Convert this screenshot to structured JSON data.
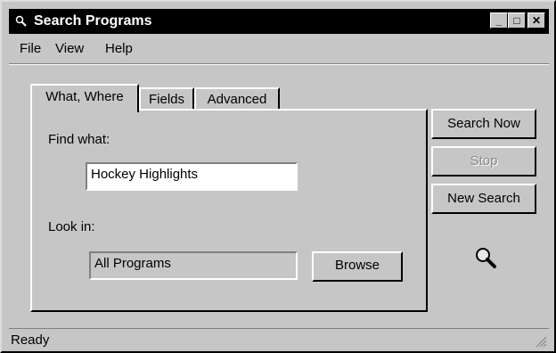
{
  "window": {
    "title": "Search Programs"
  },
  "titlebar_buttons": {
    "minimize": "_",
    "maximize": "□",
    "close": "✕"
  },
  "menu": {
    "file": "File",
    "view": "View",
    "help": "Help"
  },
  "tabs": [
    "What, Where",
    "Fields",
    "Advanced"
  ],
  "form": {
    "find_label": "Find what:",
    "find_value": "Hockey Highlights",
    "lookin_label": "Look in:",
    "lookin_value": "All Programs",
    "browse_label": "Browse"
  },
  "buttons": {
    "search_now": "Search Now",
    "stop": "Stop",
    "new_search": "New Search"
  },
  "status": {
    "text": "Ready"
  },
  "icons": {
    "title": "search-icon",
    "magnifier": "magnifier-icon",
    "grip": "resize-grip-icon"
  }
}
